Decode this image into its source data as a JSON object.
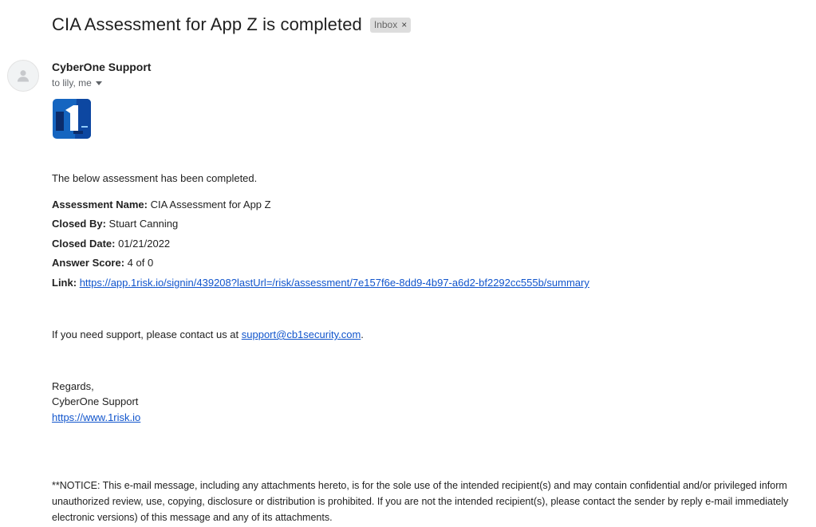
{
  "email": {
    "subject": "CIA Assessment for App Z is completed",
    "label": "Inbox",
    "label_close": "×",
    "sender": "CyberOne Support",
    "recipients": "to lily, me"
  },
  "body": {
    "intro": "The below assessment has been completed.",
    "fields": {
      "assessment_name_label": "Assessment Name:",
      "assessment_name_value": "CIA Assessment for App Z",
      "closed_by_label": "Closed By:",
      "closed_by_value": "Stuart Canning",
      "closed_date_label": "Closed Date:",
      "closed_date_value": "01/21/2022",
      "answer_score_label": "Answer Score:",
      "answer_score_value": "4 of 0",
      "link_label": "Link:",
      "link_value": "https://app.1risk.io/signin/439208?lastUrl=/risk/assessment/7e157f6e-8dd9-4b97-a6d2-bf2292cc555b/summary"
    },
    "support_prefix": "If you need support, please contact us at ",
    "support_email": "support@cb1security.com",
    "support_suffix": ".",
    "regards": "Regards,",
    "signature_name": "CyberOne Support",
    "signature_url": "https://www.1risk.io",
    "notice_lines": [
      "**NOTICE: This e-mail message, including any attachments hereto, is for the sole use of the intended recipient(s) and may contain confidential and/or privileged inform",
      "unauthorized review, use, copying, disclosure or distribution is prohibited. If you are not the intended recipient(s), please contact the sender by reply e-mail immediately",
      "electronic versions) of this message and any of its attachments."
    ]
  },
  "colors": {
    "link": "#1155cc",
    "logo_blue": "#1565c0",
    "logo_dark": "#0b2c6b"
  },
  "icons": {
    "avatar": "person-icon",
    "label_close": "close-icon",
    "recipients_toggle": "caret-down-icon",
    "logo": "1risk-logo"
  }
}
